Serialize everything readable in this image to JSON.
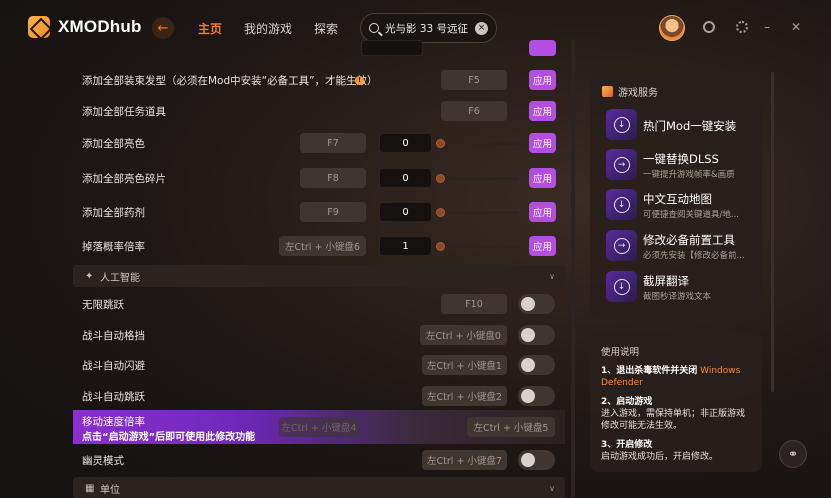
{
  "app": {
    "logo_text": "XMODhub"
  },
  "nav": {
    "items": [
      "主页",
      "我的游戏",
      "探索"
    ],
    "active_index": 0
  },
  "search": {
    "value": "光与影 33 号远征"
  },
  "list": {
    "rows": [
      {
        "label": "添加全部装束发型（必须在Mod中安装“必备工具”，才能生效）",
        "key": "F5",
        "apply": "应用"
      },
      {
        "label": "添加全部任务道具",
        "key": "F6",
        "apply": "应用"
      },
      {
        "label": "添加全部亮色",
        "key": "F7",
        "value": "0",
        "apply": "应用"
      },
      {
        "label": "添加全部亮色碎片",
        "key": "F8",
        "value": "0",
        "apply": "应用"
      },
      {
        "label": "添加全部药剂",
        "key": "F9",
        "value": "0",
        "apply": "应用"
      },
      {
        "label": "掉落概率倍率",
        "key": "左Ctrl + 小键盘6",
        "value": "1",
        "apply": "应用"
      }
    ],
    "section_ai": "人工智能",
    "toggles": [
      {
        "label": "无限跳跃",
        "key": "F10"
      },
      {
        "label": "战斗自动格挡",
        "key": "左Ctrl + 小键盘0"
      },
      {
        "label": "战斗自动闪避",
        "key": "左Ctrl + 小键盘1"
      },
      {
        "label": "战斗自动跳跃",
        "key": "左Ctrl + 小键盘2"
      }
    ],
    "highlight": {
      "title": "移动速度倍率",
      "subtitle": "点击“启动游戏”后即可使用此修改功能",
      "key1": "左Ctrl + 小键盘4",
      "key2": "左Ctrl + 小键盘5"
    },
    "ghost": {
      "label": "幽灵模式",
      "key": "左Ctrl + 小键盘7"
    },
    "section_unit": "单位"
  },
  "services": {
    "title": "游戏服务",
    "items": [
      {
        "name": "热门Mod一键安装",
        "desc": ""
      },
      {
        "name": "一键替换DLSS",
        "desc": "一键提升游戏帧率&画质"
      },
      {
        "name": "中文互动地图",
        "desc": "可便捷查阅关键道具/地..."
      },
      {
        "name": "修改必备前置工具",
        "desc": "必须先安装【修改必备前..."
      },
      {
        "name": "截屏翻译",
        "desc": "截图秒译游戏文本"
      }
    ]
  },
  "usage": {
    "title": "使用说明",
    "step1_title": "1、退出杀毒软件并关闭",
    "step1_highlight": "Windows Defender",
    "step2_title": "2、启动游戏",
    "step2_text": "进入游戏，需保持单机；非正版游戏修改可能无法生效。",
    "step3_title": "3、开启修改",
    "step3_text": "启动游戏成功后，开启修改。"
  },
  "colors": {
    "accent": "#ff7a2b",
    "apply": "#b24fe0",
    "highlight": "#8a2fd0"
  }
}
